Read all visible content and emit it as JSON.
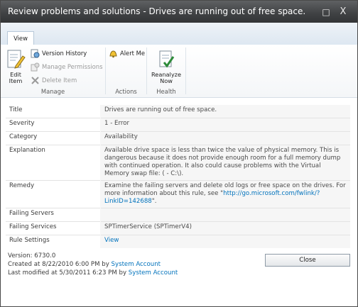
{
  "window": {
    "title": "Review problems and solutions - Drives are running out of free space.",
    "maximize_glyph": "□",
    "close_glyph": "X"
  },
  "ribbon": {
    "tabs": [
      {
        "label": "View"
      }
    ],
    "groups": [
      {
        "label": "Manage",
        "big_button": {
          "label_line1": "Edit",
          "label_line2": "Item",
          "icon": "edit-icon"
        },
        "small_buttons": [
          {
            "label": "Version History",
            "icon": "version-history-icon",
            "enabled": true
          },
          {
            "label": "Manage Permissions",
            "icon": "permissions-icon",
            "enabled": false
          },
          {
            "label": "Delete Item",
            "icon": "delete-icon",
            "enabled": false
          }
        ]
      },
      {
        "label": "Actions",
        "small_buttons": [
          {
            "label": "Alert Me",
            "icon": "alert-icon",
            "enabled": true
          }
        ]
      },
      {
        "label": "Health",
        "big_button": {
          "label_line1": "Reanalyze",
          "label_line2": "Now",
          "icon": "reanalyze-icon"
        }
      }
    ]
  },
  "properties": [
    {
      "label": "Title",
      "value": "Drives are running out of free space."
    },
    {
      "label": "Severity",
      "value": "1 - Error"
    },
    {
      "label": "Category",
      "value": "Availability"
    },
    {
      "label": "Explanation",
      "value": "Available drive space is less than twice the value of physical memory. This is dangerous because it does not provide enough room for a full memory dump with continued operation. It also could cause problems with the Virtual Memory swap file:  (                    - C:\\)."
    },
    {
      "label": "Remedy",
      "value_prefix": "Examine the failing servers and delete old logs or free space on the drives. For more information about this rule, see \"",
      "link": "http://go.microsoft.com/fwlink/?LinkID=142688",
      "value_suffix": "\"."
    },
    {
      "label": "Failing Servers",
      "value": ""
    },
    {
      "label": "Failing Services",
      "value": "SPTimerService (SPTimerV4)"
    },
    {
      "label": "Rule Settings",
      "link": "View"
    }
  ],
  "footer": {
    "version": "Version: 6730.0",
    "created_prefix": "Created at 8/22/2010 6:00 PM  by",
    "created_by": "System Account",
    "modified_prefix": "Last modified at 5/30/2011 6:23 PM  by",
    "modified_by": "System Account"
  },
  "close_button": "Close",
  "colors": {
    "link": "#0072bc",
    "titlebar": "#3f4143",
    "ribbon_tab_bg": "#dde7f1"
  }
}
